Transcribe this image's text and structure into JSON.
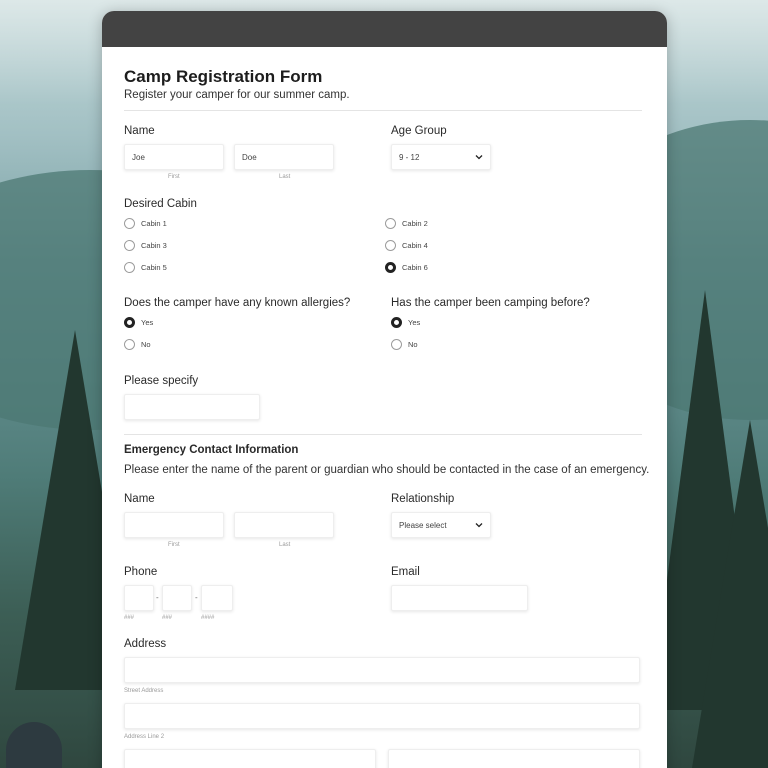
{
  "form": {
    "title": "Camp Registration Form",
    "subtitle": "Register your camper for our summer camp."
  },
  "camper": {
    "name_label": "Name",
    "first_value": "Joe",
    "last_value": "Doe",
    "first_sublabel": "First",
    "last_sublabel": "Last",
    "age_group_label": "Age Group",
    "age_group_value": "9 - 12"
  },
  "cabin": {
    "label": "Desired Cabin",
    "options": [
      "Cabin 1",
      "Cabin 2",
      "Cabin 3",
      "Cabin 4",
      "Cabin 5",
      "Cabin 6"
    ],
    "selected": "Cabin 6"
  },
  "allergies": {
    "label": "Does the camper have any known allergies?",
    "yes": "Yes",
    "no": "No",
    "selected": "Yes"
  },
  "camping_before": {
    "label": "Has the camper been camping before?",
    "yes": "Yes",
    "no": "No",
    "selected": "Yes"
  },
  "specify": {
    "label": "Please specify",
    "value": ""
  },
  "emergency": {
    "section_title": "Emergency Contact Information",
    "description": "Please enter the name of the parent or guardian who should be contacted in the case of an emergency.",
    "name_label": "Name",
    "first_sublabel": "First",
    "last_sublabel": "Last",
    "relationship_label": "Relationship",
    "relationship_value": "Please select",
    "phone_label": "Phone",
    "phone_sublabels": [
      "###",
      "###",
      "####"
    ],
    "phone_separator": "-",
    "email_label": "Email",
    "address_label": "Address",
    "street_sublabel": "Street Address",
    "line2_sublabel": "Address Line 2"
  },
  "colors": {
    "header_bar": "#434343",
    "card_bg": "#ffffff",
    "radio_selected": "#222222"
  }
}
